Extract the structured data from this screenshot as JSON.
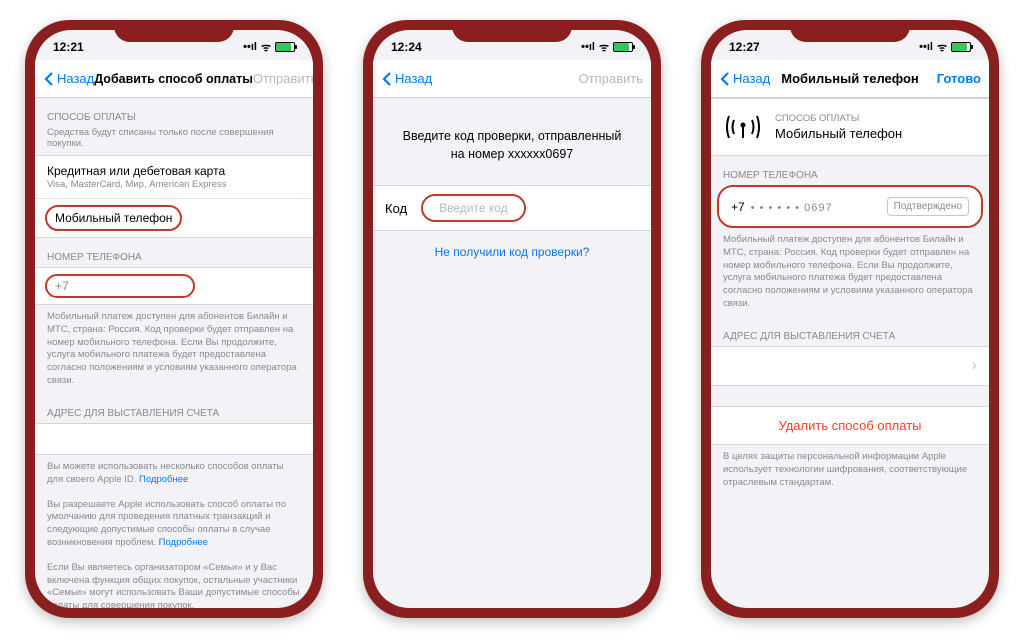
{
  "status": {
    "time1": "12:21",
    "time2": "12:24",
    "time3": "12:27",
    "signal": "▪▪▪▪",
    "wifi": "ᯤ"
  },
  "screen1": {
    "nav_back": "Назад",
    "nav_title": "Добавить способ оплаты",
    "nav_action": "Отправить",
    "section_method": "СПОСОБ ОПЛАТЫ",
    "section_method_sub": "Средства будут списаны только после совершения покупки.",
    "card_title": "Кредитная или дебетовая карта",
    "card_sub": "Visa, MasterCard, Мир, American Express",
    "mobile_title": "Мобильный телефон",
    "section_phone": "НОМЕР ТЕЛЕФОНА",
    "phone_prefix": "+7",
    "phone_footer": "Мобильный платеж доступен для абонентов Билайн и МТС, страна: Россия. Код проверки будет отправлен на номер мобильного телефона. Если Вы продолжите, услуга мобильного платежа будет предоставлена согласно положениям и условиям указанного оператора связи.",
    "section_billing": "АДРЕС ДЛЯ ВЫСТАВЛЕНИЯ СЧЕТА",
    "footer1_a": "Вы можете использовать несколько способов оплаты для своего Apple ID. ",
    "footer1_link": "Подробнее",
    "footer2_a": "Вы разрешаете Apple использовать способ оплаты по умолчанию для проведения платных транзакций и следующие допустимые способы оплаты в случае возникновения проблем. ",
    "footer2_link": "Подробнее",
    "footer3": "Если Вы являетесь организатором «Семьи» и у Вас включена функция общих покупок, остальные участники «Семьи» могут использовать Ваши допустимые способы оплаты для совершения покупок."
  },
  "screen2": {
    "nav_back": "Назад",
    "nav_action": "Отправить",
    "prompt": "Введите код проверки, отправленный на номер xxxxxx0697",
    "code_label": "Код",
    "code_placeholder": "Введите код",
    "resend_link": "Не получили код проверки?"
  },
  "screen3": {
    "nav_back": "Назад",
    "nav_title": "Мобильный телефон",
    "nav_action": "Готово",
    "method_label": "СПОСОБ ОПЛАТЫ",
    "method_value": "Мобильный телефон",
    "section_phone": "НОМЕР ТЕЛЕФОНА",
    "phone_prefix": "+7",
    "phone_masked": "• • • • • • 0697",
    "confirmed": "Подтверждено",
    "phone_footer": "Мобильный платеж доступен для абонентов Билайн и МТС, страна: Россия. Код проверки будет отправлен на номер мобильного телефона. Если Вы продолжите, услуга мобильного платежа будет предоставлена согласно положениям и условиям указанного оператора связи.",
    "section_billing": "АДРЕС ДЛЯ ВЫСТАВЛЕНИЯ СЧЕТА",
    "delete": "Удалить способ оплаты",
    "security_footer": "В целях защиты персональной информации Apple использует технологии шифрования, соответствующие отраслевым стандартам."
  }
}
